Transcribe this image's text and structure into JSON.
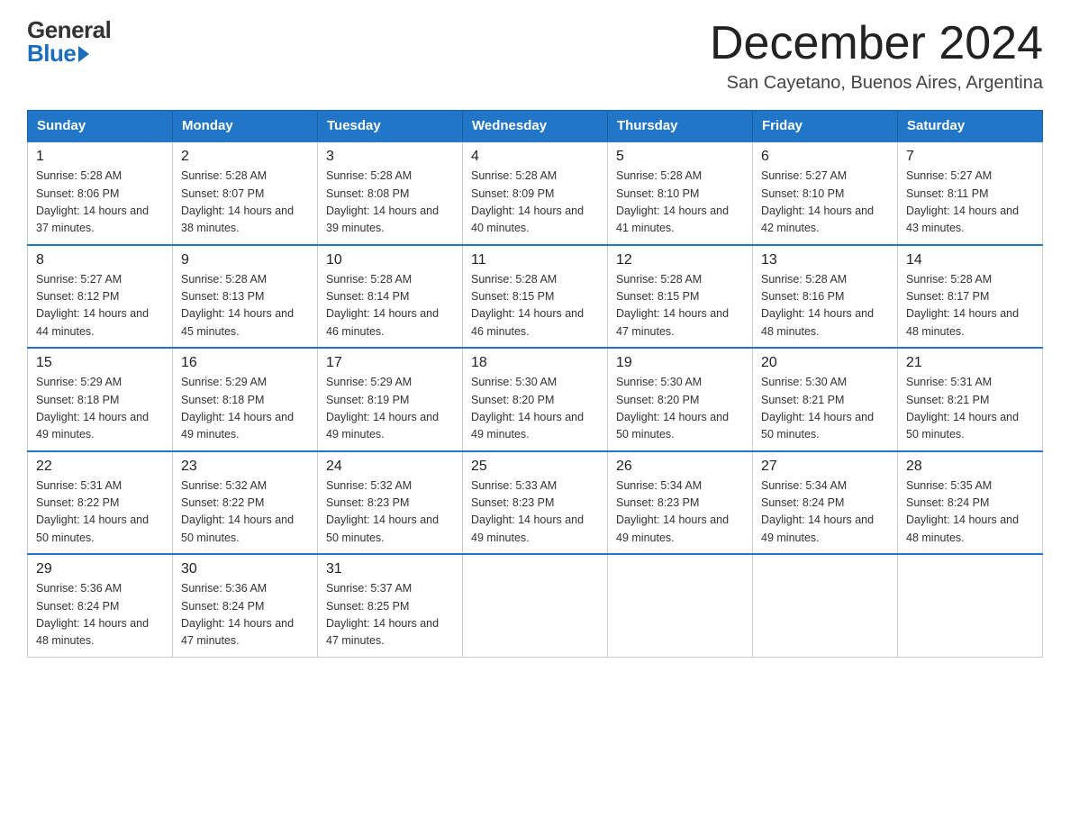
{
  "logo": {
    "general": "General",
    "blue": "Blue"
  },
  "header": {
    "month": "December 2024",
    "location": "San Cayetano, Buenos Aires, Argentina"
  },
  "weekdays": [
    "Sunday",
    "Monday",
    "Tuesday",
    "Wednesday",
    "Thursday",
    "Friday",
    "Saturday"
  ],
  "weeks": [
    [
      {
        "day": "1",
        "sunrise": "5:28 AM",
        "sunset": "8:06 PM",
        "daylight": "14 hours and 37 minutes."
      },
      {
        "day": "2",
        "sunrise": "5:28 AM",
        "sunset": "8:07 PM",
        "daylight": "14 hours and 38 minutes."
      },
      {
        "day": "3",
        "sunrise": "5:28 AM",
        "sunset": "8:08 PM",
        "daylight": "14 hours and 39 minutes."
      },
      {
        "day": "4",
        "sunrise": "5:28 AM",
        "sunset": "8:09 PM",
        "daylight": "14 hours and 40 minutes."
      },
      {
        "day": "5",
        "sunrise": "5:28 AM",
        "sunset": "8:10 PM",
        "daylight": "14 hours and 41 minutes."
      },
      {
        "day": "6",
        "sunrise": "5:27 AM",
        "sunset": "8:10 PM",
        "daylight": "14 hours and 42 minutes."
      },
      {
        "day": "7",
        "sunrise": "5:27 AM",
        "sunset": "8:11 PM",
        "daylight": "14 hours and 43 minutes."
      }
    ],
    [
      {
        "day": "8",
        "sunrise": "5:27 AM",
        "sunset": "8:12 PM",
        "daylight": "14 hours and 44 minutes."
      },
      {
        "day": "9",
        "sunrise": "5:28 AM",
        "sunset": "8:13 PM",
        "daylight": "14 hours and 45 minutes."
      },
      {
        "day": "10",
        "sunrise": "5:28 AM",
        "sunset": "8:14 PM",
        "daylight": "14 hours and 46 minutes."
      },
      {
        "day": "11",
        "sunrise": "5:28 AM",
        "sunset": "8:15 PM",
        "daylight": "14 hours and 46 minutes."
      },
      {
        "day": "12",
        "sunrise": "5:28 AM",
        "sunset": "8:15 PM",
        "daylight": "14 hours and 47 minutes."
      },
      {
        "day": "13",
        "sunrise": "5:28 AM",
        "sunset": "8:16 PM",
        "daylight": "14 hours and 48 minutes."
      },
      {
        "day": "14",
        "sunrise": "5:28 AM",
        "sunset": "8:17 PM",
        "daylight": "14 hours and 48 minutes."
      }
    ],
    [
      {
        "day": "15",
        "sunrise": "5:29 AM",
        "sunset": "8:18 PM",
        "daylight": "14 hours and 49 minutes."
      },
      {
        "day": "16",
        "sunrise": "5:29 AM",
        "sunset": "8:18 PM",
        "daylight": "14 hours and 49 minutes."
      },
      {
        "day": "17",
        "sunrise": "5:29 AM",
        "sunset": "8:19 PM",
        "daylight": "14 hours and 49 minutes."
      },
      {
        "day": "18",
        "sunrise": "5:30 AM",
        "sunset": "8:20 PM",
        "daylight": "14 hours and 49 minutes."
      },
      {
        "day": "19",
        "sunrise": "5:30 AM",
        "sunset": "8:20 PM",
        "daylight": "14 hours and 50 minutes."
      },
      {
        "day": "20",
        "sunrise": "5:30 AM",
        "sunset": "8:21 PM",
        "daylight": "14 hours and 50 minutes."
      },
      {
        "day": "21",
        "sunrise": "5:31 AM",
        "sunset": "8:21 PM",
        "daylight": "14 hours and 50 minutes."
      }
    ],
    [
      {
        "day": "22",
        "sunrise": "5:31 AM",
        "sunset": "8:22 PM",
        "daylight": "14 hours and 50 minutes."
      },
      {
        "day": "23",
        "sunrise": "5:32 AM",
        "sunset": "8:22 PM",
        "daylight": "14 hours and 50 minutes."
      },
      {
        "day": "24",
        "sunrise": "5:32 AM",
        "sunset": "8:23 PM",
        "daylight": "14 hours and 50 minutes."
      },
      {
        "day": "25",
        "sunrise": "5:33 AM",
        "sunset": "8:23 PM",
        "daylight": "14 hours and 49 minutes."
      },
      {
        "day": "26",
        "sunrise": "5:34 AM",
        "sunset": "8:23 PM",
        "daylight": "14 hours and 49 minutes."
      },
      {
        "day": "27",
        "sunrise": "5:34 AM",
        "sunset": "8:24 PM",
        "daylight": "14 hours and 49 minutes."
      },
      {
        "day": "28",
        "sunrise": "5:35 AM",
        "sunset": "8:24 PM",
        "daylight": "14 hours and 48 minutes."
      }
    ],
    [
      {
        "day": "29",
        "sunrise": "5:36 AM",
        "sunset": "8:24 PM",
        "daylight": "14 hours and 48 minutes."
      },
      {
        "day": "30",
        "sunrise": "5:36 AM",
        "sunset": "8:24 PM",
        "daylight": "14 hours and 47 minutes."
      },
      {
        "day": "31",
        "sunrise": "5:37 AM",
        "sunset": "8:25 PM",
        "daylight": "14 hours and 47 minutes."
      },
      null,
      null,
      null,
      null
    ]
  ]
}
